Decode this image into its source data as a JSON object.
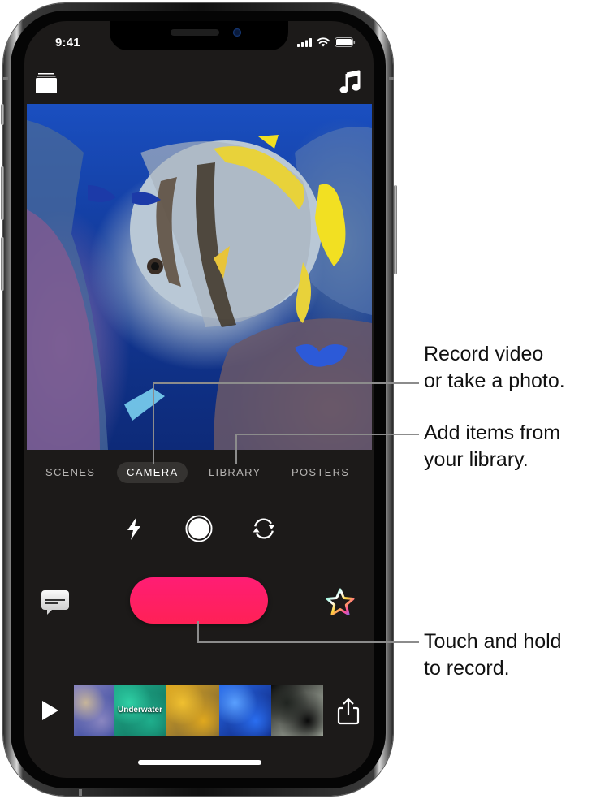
{
  "status_bar": {
    "time": "9:41",
    "icons": [
      "cellular-signal-icon",
      "wifi-icon",
      "battery-icon"
    ]
  },
  "toolbar": {
    "projects_icon": "projects-stack-icon",
    "music_icon": "music-note-icon"
  },
  "viewfinder": {
    "description": "Live camera view of a batfish swimming among coral reef"
  },
  "modes": {
    "items": [
      {
        "label": "SCENES",
        "active": false
      },
      {
        "label": "CAMERA",
        "active": true
      },
      {
        "label": "LIBRARY",
        "active": false
      },
      {
        "label": "POSTERS",
        "active": false
      }
    ]
  },
  "camera_controls": {
    "flash_icon": "flash-icon",
    "shutter_icon": "photo-shutter-icon",
    "flip_icon": "flip-camera-icon"
  },
  "record": {
    "titles_icon": "live-titles-icon",
    "effects_icon": "effects-star-icon",
    "record_color": "#ff1f64"
  },
  "timeline": {
    "play_icon": "play-icon",
    "share_icon": "share-icon",
    "clips": [
      {
        "label": "",
        "colors": [
          "#8a86c0",
          "#2b3f9a",
          "#c7b59a"
        ]
      },
      {
        "label": "Underwater",
        "colors": [
          "#1fae8c",
          "#0f6a58",
          "#2fd0a5"
        ]
      },
      {
        "label": "",
        "colors": [
          "#e0a81e",
          "#6a5a3a",
          "#f0c030"
        ]
      },
      {
        "label": "",
        "colors": [
          "#2a6ef0",
          "#0a1a6a",
          "#5aa0ff"
        ]
      },
      {
        "label": "",
        "colors": [
          "#0a0a0a",
          "#cfd8c8",
          "#202420"
        ]
      }
    ]
  },
  "callouts": [
    {
      "text": "Record video\nor take a photo."
    },
    {
      "text": "Add items from\nyour library."
    },
    {
      "text": "Touch and hold\nto record."
    }
  ],
  "colors": {
    "screen_bg": "#1c1a19",
    "record_pink": "#ff1f64",
    "active_mode_bg": "#353331",
    "callout_line": "#8c8c8c"
  }
}
